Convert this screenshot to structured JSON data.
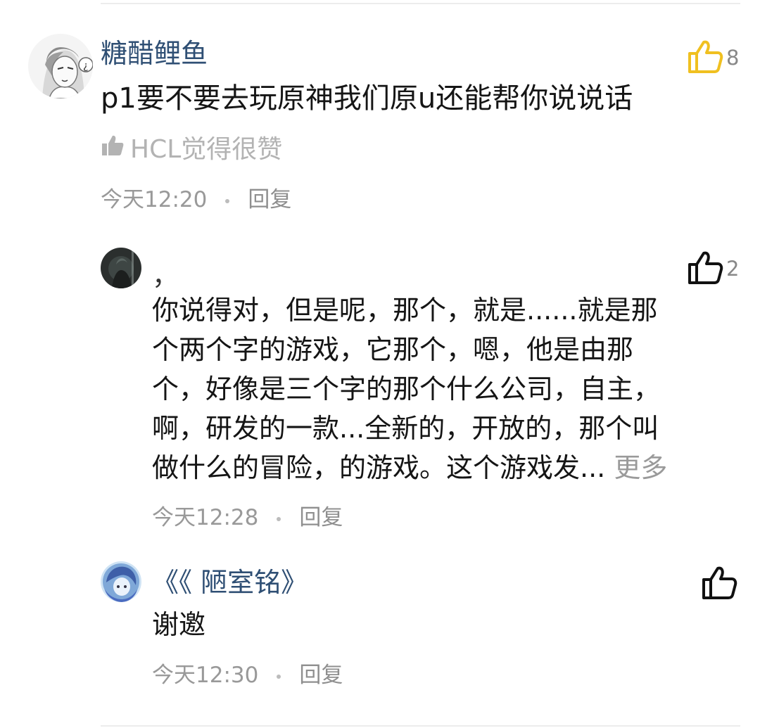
{
  "comments": [
    {
      "username": "糖醋鲤鱼",
      "text": "p1要不要去玩原神我们原u还能帮你说说话",
      "liked_by": "HCL觉得很赞",
      "time": "今天12:20",
      "reply": "回复",
      "likes": "8",
      "like_icon": "thumbs-up-icon",
      "like_color": "#f0c020"
    },
    {
      "username": "，",
      "lines": [
        "你说得对，但是呢，那个，就是......就是那",
        "个两个字的游戏，它那个，嗯，他是由那",
        "个，好像是三个字的那个什么公司，自主，",
        "啊，研发的一款...全新的，开放的，那个叫",
        "做什么的冒险，的游戏。这个游戏发..."
      ],
      "more": "更多",
      "time": "今天12:28",
      "reply": "回复",
      "likes": "2",
      "like_icon": "thumbs-up-icon"
    },
    {
      "username": "《《 陋室铭》",
      "text": "谢邀",
      "time": "今天12:30",
      "reply": "回复",
      "likes": "",
      "like_icon": "thumbs-up-icon"
    }
  ]
}
